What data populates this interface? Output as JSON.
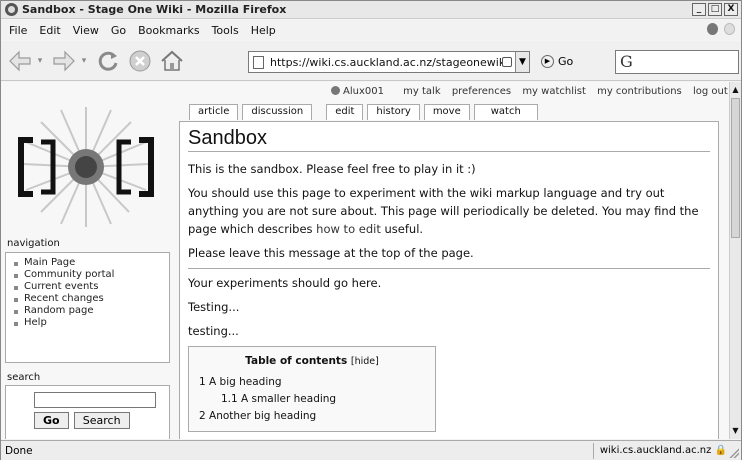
{
  "window": {
    "title": "Sandbox - Stage One Wiki - Mozilla Firefox",
    "buttons": {
      "minimize": "_",
      "maximize": "□",
      "close": "X"
    }
  },
  "menu": [
    "File",
    "Edit",
    "View",
    "Go",
    "Bookmarks",
    "Tools",
    "Help"
  ],
  "toolbar": {
    "url": "https://wiki.cs.auckland.ac.nz/stageonewiki/index.php/Sand",
    "go_label": "Go",
    "search_glyph": "G"
  },
  "personal": {
    "user": "Alux001",
    "my_talk": "my talk",
    "preferences": "preferences",
    "my_watchlist": "my watchlist",
    "my_contributions": "my contributions",
    "log_out": "log out"
  },
  "tabs": {
    "article": "article",
    "discussion": "discussion",
    "edit": "edit",
    "history": "history",
    "move": "move",
    "watch": "watch"
  },
  "sidebar": {
    "navigation_title": "navigation",
    "items": [
      "Main Page",
      "Community portal",
      "Current events",
      "Recent changes",
      "Random page",
      "Help"
    ],
    "search_title": "search",
    "go_button": "Go",
    "search_button": "Search"
  },
  "article": {
    "title": "Sandbox",
    "p1": "This is the sandbox. Please feel free to play in it :)",
    "p2_before": "You should use this page to experiment with the wiki markup language and try out anything you are not sure about. This page will periodically be deleted. You may find the page which describes ",
    "p2_link": "how to edit",
    "p2_after": " useful.",
    "p3": "Please leave this message at the top of the page.",
    "p4": "Your experiments should go here.",
    "p5": "Testing...",
    "p6": "testing...",
    "toc": {
      "title": "Table of contents",
      "hide": "[hide]",
      "entries": [
        "1 A big heading",
        "1.1 A smaller heading",
        "2 Another big heading"
      ]
    }
  },
  "status": {
    "text": "Done",
    "host": "wiki.cs.auckland.ac.nz"
  }
}
